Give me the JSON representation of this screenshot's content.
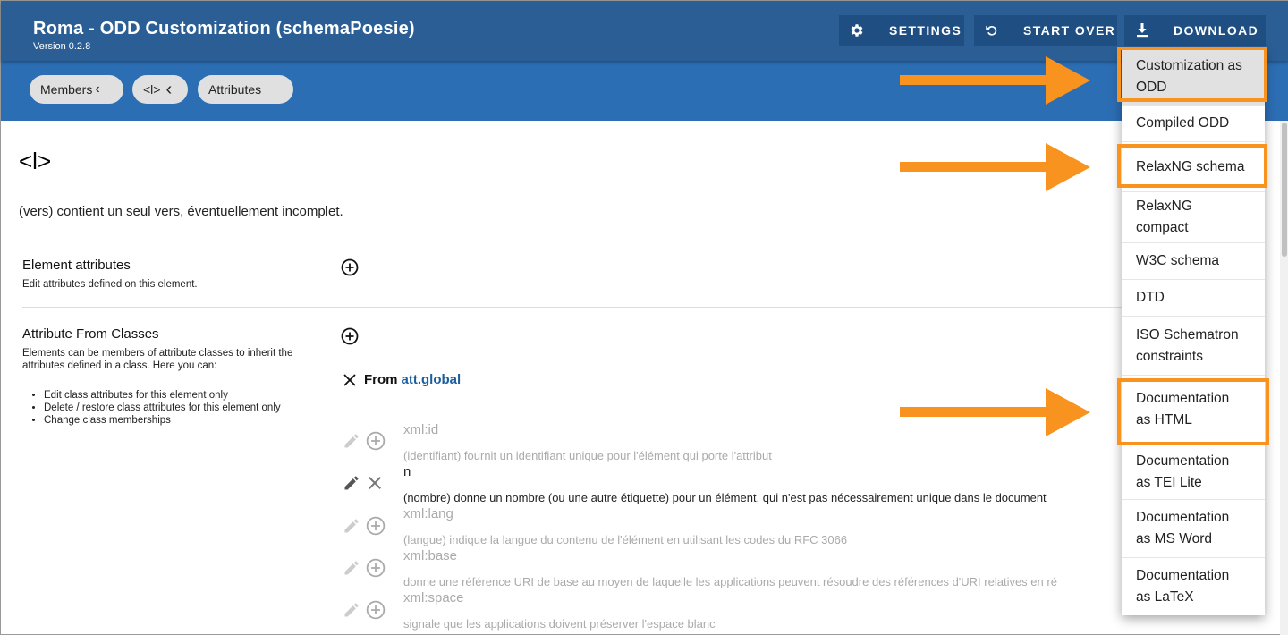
{
  "header": {
    "title": "Roma - ODD Customization (schemaPoesie)",
    "version": "Version 0.2.8",
    "settings_label": "SETTINGS",
    "start_over_label": "START OVER",
    "download_label": "DOWNLOAD"
  },
  "breadcrumbs": [
    {
      "label": "Members",
      "chevron": "‹"
    },
    {
      "label": "<l>",
      "chevron": "‹"
    },
    {
      "label": "Attributes"
    }
  ],
  "element": {
    "title": "<l>",
    "description": "(vers) contient un seul vers, éventuellement incomplet."
  },
  "sections": {
    "element_attributes": {
      "title": "Element attributes",
      "subtitle": "Edit attributes defined on this element."
    },
    "attribute_from_classes": {
      "title": "Attribute From Classes",
      "subtitle": "Elements can be members of attribute classes to inherit the attributes defined in a class. Here you can:",
      "bullets": [
        "Edit class attributes for this element only",
        "Delete / restore class attributes for this element only",
        "Change class memberships"
      ]
    }
  },
  "class_group": {
    "from_label": "From",
    "class_name": "att.global"
  },
  "attributes": [
    {
      "name": "xml:id",
      "description": "(identifiant) fournit un identifiant unique pour l'élément qui porte l'attribut",
      "active": false
    },
    {
      "name": "n",
      "description": "(nombre) donne un nombre (ou une autre étiquette) pour un élément, qui n'est pas nécessairement unique dans le document",
      "active": true
    },
    {
      "name": "xml:lang",
      "description": "(langue) indique la langue du contenu de l'élément en utilisant les codes du RFC 3066",
      "active": false
    },
    {
      "name": "xml:base",
      "description": "donne une référence URI de base au moyen de laquelle les applications peuvent résoudre des références d'URI relatives en ré",
      "active": false
    },
    {
      "name": "xml:space",
      "description": "signale que les applications doivent préserver l'espace blanc",
      "active": false
    }
  ],
  "download_menu": {
    "items": [
      {
        "line1": "Customization as",
        "line2": "ODD"
      },
      {
        "line1": "Compiled ODD",
        "line2": ""
      },
      {
        "line1": "RelaxNG schema",
        "line2": ""
      },
      {
        "line1": "RelaxNG",
        "line2": "compact"
      },
      {
        "line1": "W3C schema",
        "line2": ""
      },
      {
        "line1": "DTD",
        "line2": ""
      },
      {
        "line1": "ISO Schematron",
        "line2": "constraints"
      },
      {
        "line1": "Documentation",
        "line2": "as HTML"
      },
      {
        "line1": "Documentation",
        "line2": "as TEI Lite"
      },
      {
        "line1": "Documentation",
        "line2": "as MS Word"
      },
      {
        "line1": "Documentation",
        "line2": "as LaTeX"
      }
    ]
  },
  "colors": {
    "header": "#2a5e95",
    "subbar": "#2c6eb4",
    "annotation": "#f7931e",
    "link": "#1b5e9e"
  }
}
